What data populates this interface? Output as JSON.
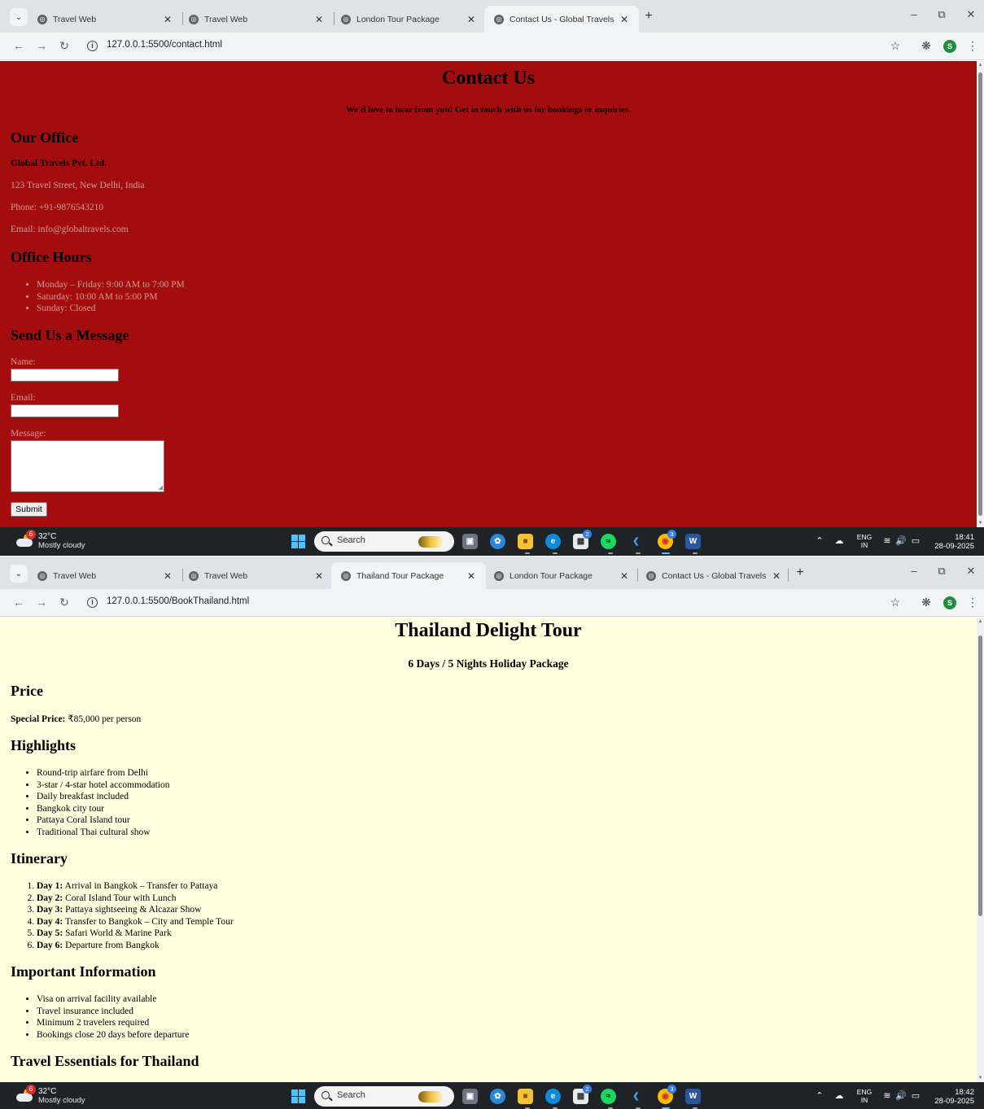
{
  "top_window": {
    "tabs": [
      {
        "label": "Travel Web",
        "active": false
      },
      {
        "label": "Travel Web",
        "active": false
      },
      {
        "label": "London Tour Package",
        "active": false
      },
      {
        "label": "Contact Us - Global Travels",
        "active": true
      }
    ],
    "url": "127.0.0.1:5500/contact.html",
    "page": {
      "background": "#a30d0d",
      "title": "Contact Us",
      "lead": "We'd love to hear from you! Get in touch with us for bookings or inquiries.",
      "office": {
        "heading": "Our Office",
        "company": "Global Travels Pvt. Ltd.",
        "address": "123 Travel Street, New Delhi, India",
        "phone": "Phone: +91-9876543210",
        "email": "Email: info@globaltravels.com"
      },
      "hours": {
        "heading": "Office Hours",
        "items": [
          "Monday – Friday: 9:00 AM to 7:00 PM",
          "Saturday: 10:00 AM to 5:00 PM",
          "Sunday: Closed"
        ]
      },
      "form": {
        "heading": "Send Us a Message",
        "name_label": "Name:",
        "name_value": "",
        "email_label": "Email:",
        "email_value": "",
        "message_label": "Message:",
        "message_value": "",
        "submit_label": "Submit"
      }
    },
    "taskbar": {
      "temp": "32°C",
      "weather": "Mostly cloudy",
      "weather_badge": "6",
      "search": "Search",
      "lang": "ENG",
      "region": "IN",
      "time": "18:41",
      "date": "28-09-2025"
    }
  },
  "bottom_window": {
    "tabs": [
      {
        "label": "Travel Web",
        "active": false
      },
      {
        "label": "Travel Web",
        "active": false
      },
      {
        "label": "Thailand Tour Package",
        "active": true
      },
      {
        "label": "London Tour Package",
        "active": false
      },
      {
        "label": "Contact Us - Global Travels",
        "active": false
      }
    ],
    "url": "127.0.0.1:5500/BookThailand.html",
    "page": {
      "background": "#ffffe0",
      "title": "Thailand Delight Tour",
      "subtitle": "6 Days / 5 Nights Holiday Package",
      "price": {
        "heading": "Price",
        "label": "Special Price:",
        "value": "₹85,000 per person"
      },
      "highlights": {
        "heading": "Highlights",
        "items": [
          "Round-trip airfare from Delhi",
          "3-star / 4-star hotel accommodation",
          "Daily breakfast included",
          "Bangkok city tour",
          "Pattaya Coral Island tour",
          "Traditional Thai cultural show"
        ]
      },
      "itinerary": {
        "heading": "Itinerary",
        "items": [
          {
            "day": "Day 1:",
            "text": "Arrival in Bangkok – Transfer to Pattaya"
          },
          {
            "day": "Day 2:",
            "text": "Coral Island Tour with Lunch"
          },
          {
            "day": "Day 3:",
            "text": "Pattaya sightseeing & Alcazar Show"
          },
          {
            "day": "Day 4:",
            "text": "Transfer to Bangkok – City and Temple Tour"
          },
          {
            "day": "Day 5:",
            "text": "Safari World & Marine Park"
          },
          {
            "day": "Day 6:",
            "text": "Departure from Bangkok"
          }
        ]
      },
      "info": {
        "heading": "Important Information",
        "items": [
          "Visa on arrival facility available",
          "Travel insurance included",
          "Minimum 2 travelers required",
          "Bookings close 20 days before departure"
        ]
      },
      "essentials_heading": "Travel Essentials for Thailand"
    },
    "taskbar": {
      "temp": "32°C",
      "weather": "Mostly cloudy",
      "weather_badge": "6",
      "search": "Search",
      "lang": "ENG",
      "region": "IN",
      "time": "18:42",
      "date": "28-09-2025"
    }
  },
  "colors": {
    "chrome_tabstrip": "#dfe3e7",
    "chrome_toolbar": "#f1f3f4",
    "taskbar": "#1f2328",
    "accent": "#4cc2ff",
    "profile_avatar": "#1e8e3e"
  },
  "icons": {
    "profile_initial": "S",
    "store_badge": "2",
    "chrome_badge": "3"
  }
}
